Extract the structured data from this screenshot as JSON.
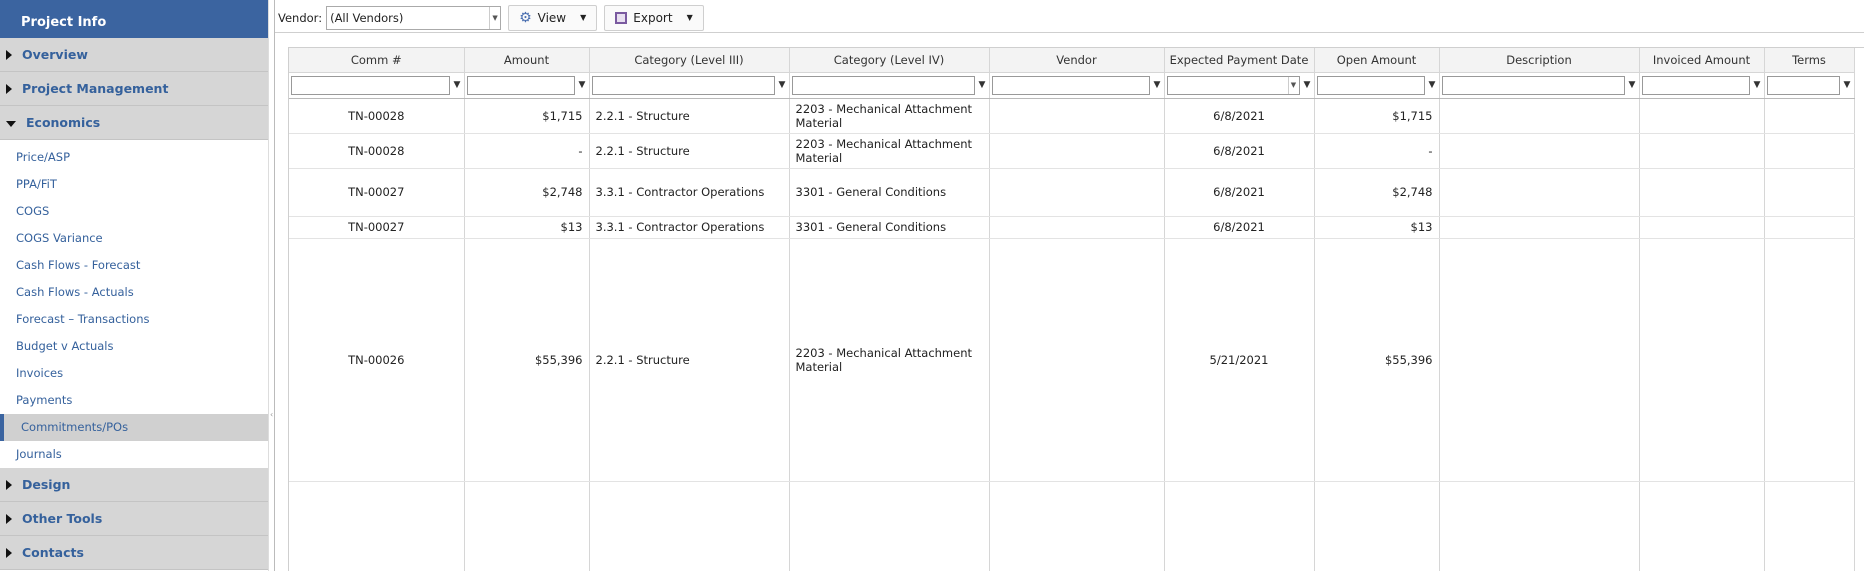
{
  "sidebar": {
    "title": "Project Info",
    "groups_top": [
      {
        "label": "Overview"
      },
      {
        "label": "Project Management"
      }
    ],
    "economics": {
      "label": "Economics",
      "items": [
        {
          "label": "Price/ASP"
        },
        {
          "label": "PPA/FiT"
        },
        {
          "label": "COGS"
        },
        {
          "label": "COGS Variance"
        },
        {
          "label": "Cash Flows - Forecast"
        },
        {
          "label": "Cash Flows - Actuals"
        },
        {
          "label": "Forecast – Transactions"
        },
        {
          "label": "Budget v Actuals"
        },
        {
          "label": "Invoices"
        },
        {
          "label": "Payments"
        },
        {
          "label": "Commitments/POs",
          "active": true
        },
        {
          "label": "Journals"
        }
      ]
    },
    "groups_bottom": [
      {
        "label": "Design"
      },
      {
        "label": "Other Tools"
      },
      {
        "label": "Contacts"
      }
    ]
  },
  "toolbar": {
    "vendor_label": "Vendor:",
    "vendor_value": "(All Vendors)",
    "view_label": "View",
    "export_label": "Export"
  },
  "grid": {
    "columns": [
      "Comm #",
      "Amount",
      "Category (Level III)",
      "Category (Level IV)",
      "Vendor",
      "Expected Payment Date",
      "Open Amount",
      "Description",
      "Invoiced Amount",
      "Terms"
    ],
    "rows": [
      {
        "comm": "TN-00028",
        "amount": "$1,715",
        "cat3": "2.2.1 - Structure",
        "cat4": "2203 - Mechanical Attachment Material",
        "vendor": "",
        "date": "6/8/2021",
        "open": "$1,715",
        "desc": "",
        "invoiced": "",
        "terms": ""
      },
      {
        "comm": "TN-00028",
        "amount": "-",
        "cat3": "2.2.1 - Structure",
        "cat4": "2203 - Mechanical Attachment Material",
        "vendor": "",
        "date": "6/8/2021",
        "open": "-",
        "desc": "",
        "invoiced": "",
        "terms": ""
      },
      {
        "comm": "TN-00027",
        "amount": "$2,748",
        "cat3": "3.3.1 - Contractor Operations",
        "cat4": "3301 - General Conditions",
        "vendor": "",
        "date": "6/8/2021",
        "open": "$2,748",
        "desc": "",
        "invoiced": "",
        "terms": ""
      },
      {
        "comm": "TN-00027",
        "amount": "$13",
        "cat3": "3.3.1 - Contractor Operations",
        "cat4": "3301 - General Conditions",
        "vendor": "",
        "date": "6/8/2021",
        "open": "$13",
        "desc": "",
        "invoiced": "",
        "terms": ""
      },
      {
        "comm": "TN-00026",
        "amount": "$55,396",
        "cat3": "2.2.1 - Structure",
        "cat4": "2203 - Mechanical Attachment Material",
        "vendor": "",
        "date": "5/21/2021",
        "open": "$55,396",
        "desc": "",
        "invoiced": "",
        "terms": ""
      }
    ]
  }
}
